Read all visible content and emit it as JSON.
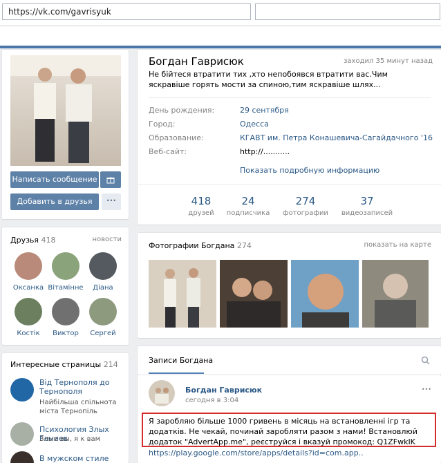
{
  "browser": {
    "url": "https://vk.com/gavrisyuk"
  },
  "profile": {
    "name": "Богдан Гаврисюк",
    "last_seen": "заходил 35 минут назад",
    "status": "Не бійтеся втратити тих ,хто непобоявся втратити вас.Чим яскравіше горять мости за спиною,тим яскравіше шлях...",
    "info": [
      {
        "label": "День рождения:",
        "value": "29 сентября"
      },
      {
        "label": "Город:",
        "value": "Одесса"
      },
      {
        "label": "Образование:",
        "value": "КГАВТ им. Петра Конашевича-Сагайдачного '16"
      },
      {
        "label": "Веб-сайт:",
        "value": "http://..........."
      }
    ],
    "show_more": "Показать подробную информацию",
    "counters": [
      {
        "num": "418",
        "label": "друзей"
      },
      {
        "num": "24",
        "label": "подписчика"
      },
      {
        "num": "274",
        "label": "фотографии"
      },
      {
        "num": "37",
        "label": "видеозаписей"
      }
    ]
  },
  "actions": {
    "message": "Написать сообщение",
    "add_friend": "Добавить в друзья",
    "more": "•••"
  },
  "friends": {
    "title": "Друзья",
    "count": "418",
    "news": "новости",
    "items": [
      {
        "name": "Оксанка",
        "color": "#b98a7a"
      },
      {
        "name": "Вітамінне",
        "color": "#8aa37a"
      },
      {
        "name": "Діана",
        "color": "#555a60"
      },
      {
        "name": "Костік",
        "color": "#6c7f5e"
      },
      {
        "name": "Виктор",
        "color": "#707070"
      },
      {
        "name": "Сергей",
        "color": "#8d9a7e"
      }
    ]
  },
  "photos": {
    "title": "Фотографии Богдана",
    "count": "274",
    "map": "показать на карте"
  },
  "pages": {
    "title": "Интересные страницы",
    "count": "214",
    "items": [
      {
        "name": "Від Тернополя до Тернополя",
        "desc": "Найбільша спільнота міста Тернопіль"
      },
      {
        "name": "Психология Злых Гениев",
        "desc": "Злые вы, я к вам"
      },
      {
        "name": "В мужском стиле",
        "desc": ""
      }
    ]
  },
  "wall": {
    "tab": "Записи Богдана",
    "author": "Богдан Гаврисюк",
    "time": "сегодня в 3:04",
    "dots": "•••",
    "text": "Я заробляю більше 1000 гривень в місяць на встановленні ігр та додатків. Не чекай, починай заробляти разом з нами! Встановлюй додаток \"AdvertApp.me\", реєструйся і вказуй промокод: Q1ZFwkIK",
    "link": "https://play.google.com/store/apps/details?id=com.app.."
  }
}
